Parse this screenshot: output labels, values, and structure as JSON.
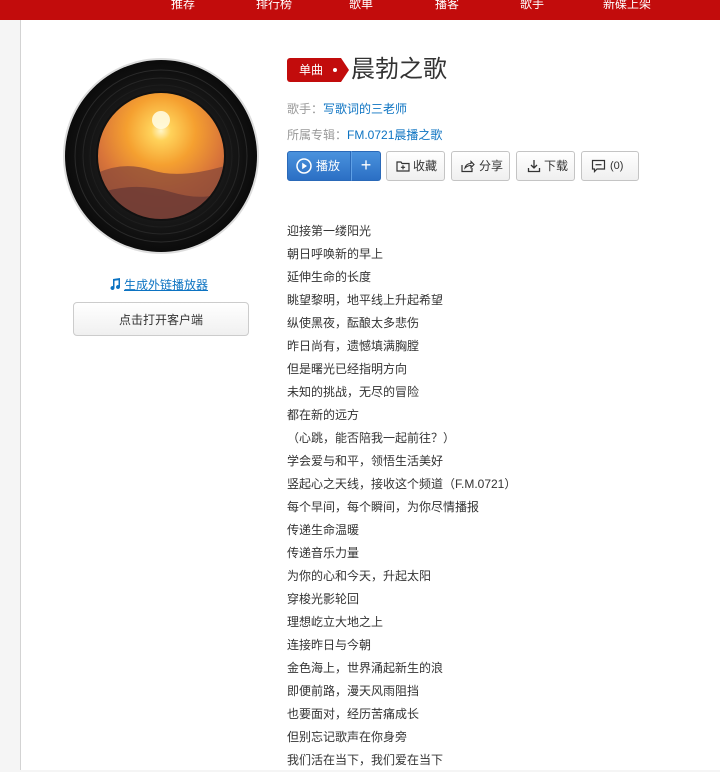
{
  "nav": {
    "items": [
      "推荐",
      "排行榜",
      "歌单",
      "播客",
      "歌手",
      "新碟上架"
    ]
  },
  "song": {
    "badge": "单曲",
    "title": "晨勃之歌",
    "artist_label": "歌手：",
    "artist": "写歌词的三老师",
    "album_label": "所属专辑：",
    "album": "FM.0721晨播之歌"
  },
  "buttons": {
    "play": "播放",
    "add": "+",
    "collect": "收藏",
    "share": "分享",
    "download": "下载",
    "comment": "(0)"
  },
  "left": {
    "ext_player_link": "生成外链播放器",
    "open_client": "点击打开客户端"
  },
  "lyrics": [
    "迎接第一缕阳光",
    "朝日呼唤新的早上",
    "延伸生命的长度",
    "眺望黎明，地平线上升起希望",
    "纵使黑夜，酝酿太多悲伤",
    "昨日尚有，遗憾填满胸膛",
    "但是曙光已经指明方向",
    "未知的挑战，无尽的冒险",
    "都在新的远方",
    "（心跳，能否陪我一起前往？）",
    "学会爱与和平，领悟生活美好",
    "竖起心之天线，接收这个频道（F.M.0721）",
    "每个早间，每个瞬间，为你尽情播报",
    "传递生命温暖",
    "传递音乐力量",
    "为你的心和今天，升起太阳",
    "穿梭光影轮回",
    "理想屹立大地之上",
    "连接昨日与今朝",
    "金色海上，世界涌起新生的浪",
    "即便前路，漫天风雨阻挡",
    "也要面对，经历苦痛成长",
    "但别忘记歌声在你身旁",
    "我们活在当下，我们爱在当下"
  ],
  "colors": {
    "brand_red": "#c20c0c",
    "link_blue": "#0c73c2",
    "play_blue": "#2b6fc4"
  }
}
